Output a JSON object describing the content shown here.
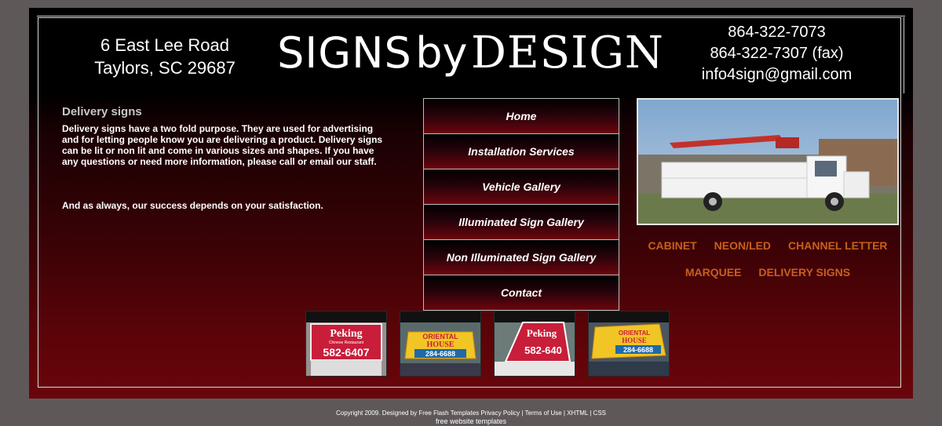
{
  "header": {
    "address_line1": "6 East Lee Road",
    "address_line2": "Taylors, SC 29687",
    "logo_word1": "SIGNS",
    "logo_word2": "by",
    "logo_word3": "DESIGN",
    "phone": "864-322-7073",
    "fax": "864-322-7307 (fax)",
    "email": "info4sign@gmail.com"
  },
  "content": {
    "title": "Delivery signs",
    "body": "Delivery signs have a two fold purpose.   They are used for advertising and for letting people know you are delivering a product.   Delivery signs can be lit or non lit and come in various sizes and shapes.   If you have any questions or need more information, please call or email our staff.",
    "tagline": "And as always, our success depends on your satisfaction."
  },
  "nav": {
    "items": [
      {
        "label": "Home"
      },
      {
        "label": "Installation Services"
      },
      {
        "label": "Vehicle Gallery"
      },
      {
        "label": "Illuminated Sign Gallery"
      },
      {
        "label": "Non Illuminated Sign Gallery"
      },
      {
        "label": "Contact"
      }
    ]
  },
  "categories": {
    "row1": [
      "CABINET",
      "NEON/LED",
      "CHANNEL LETTER"
    ],
    "row2": [
      "MARQUEE",
      "DELIVERY SIGNS"
    ]
  },
  "thumbnails": [
    {
      "line1": "Peking",
      "line2": "Chinese Restaurant",
      "line3": "582-6407",
      "bg": "#c81e3a"
    },
    {
      "line1": "ORIENTAL",
      "line2": "HOUSE",
      "line3": "284-6688",
      "bg": "#f1c526"
    },
    {
      "line1": "Peking",
      "line2": "",
      "line3": "582-640",
      "bg": "#c81e3a"
    },
    {
      "line1": "ORIENTAL",
      "line2": "HOUSE",
      "line3": "284-6688",
      "bg": "#f1c526"
    }
  ],
  "footer": {
    "copyright": "Copyright 2009. Designed by Free Flash Templates Privacy Policy | Terms of Use | XHTML | CSS",
    "free_link": "free website templates"
  },
  "colors": {
    "page_bg": "#5f5859",
    "accent_orange": "#c95f1c",
    "dark_red": "#6a050a"
  }
}
